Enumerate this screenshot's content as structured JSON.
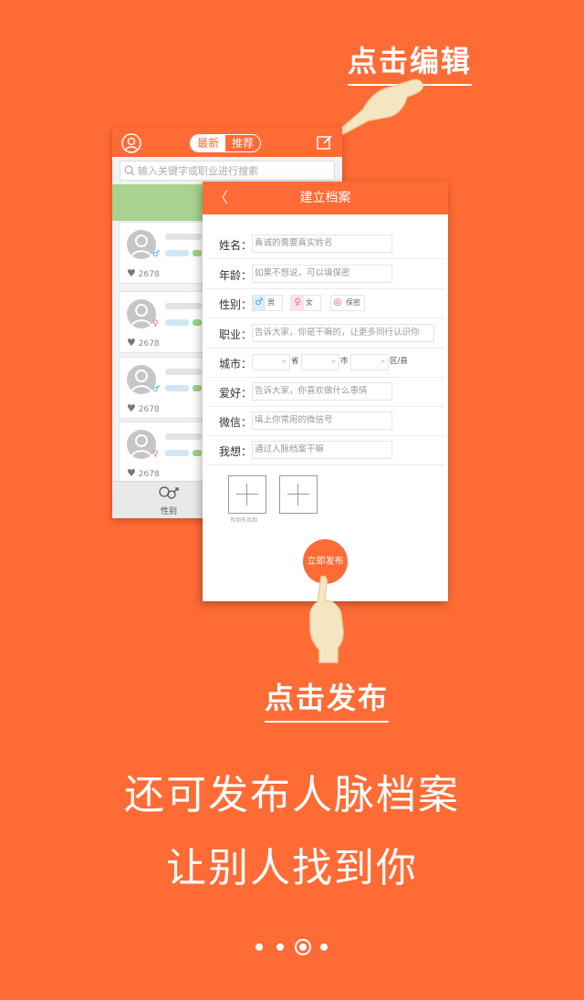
{
  "callouts": {
    "edit": "点击编辑",
    "publish": "点击发布"
  },
  "list_screen": {
    "tabs": [
      {
        "label": "最新",
        "active": true
      },
      {
        "label": "推荐",
        "active": false
      }
    ],
    "search_placeholder": "输入关键字或职业进行搜索",
    "cards": [
      {
        "likes": "2678",
        "gender_icon": "male"
      },
      {
        "likes": "2678",
        "gender_icon": "female"
      },
      {
        "likes": "2678",
        "gender_icon": "male"
      },
      {
        "likes": "2678",
        "gender_icon": "female"
      }
    ],
    "footer_tab": "性别"
  },
  "form_screen": {
    "title": "建立档案",
    "fields": {
      "name": {
        "label": "姓名：",
        "placeholder": "真诚的需要真实姓名"
      },
      "age": {
        "label": "年龄：",
        "placeholder": "如果不想说，可以填保密"
      },
      "gender": {
        "label": "性别：",
        "options": [
          "男",
          "女",
          "保密"
        ]
      },
      "job": {
        "label": "职业：",
        "placeholder": "告诉大家，你是干嘛的，让更多同行认识你"
      },
      "city": {
        "label": "城市：",
        "province": "省",
        "city": "市",
        "district": "区/县"
      },
      "hobby": {
        "label": "爱好：",
        "placeholder": "告诉大家，你喜欢做什么事情"
      },
      "wechat": {
        "label": "微信：",
        "placeholder": "填上你常用的微信号"
      },
      "want": {
        "label": "我想：",
        "placeholder": "通过人脉档案干嘛"
      }
    },
    "photo_hint": "有图有真相",
    "publish_button": "立即发布"
  },
  "headline": {
    "line1": "还可发布人脉档案",
    "line2": "让别人找到你"
  },
  "pager": {
    "count": 4,
    "active_index": 2
  },
  "colors": {
    "brand": "#ff6b35",
    "banner": "#a9d28f"
  }
}
